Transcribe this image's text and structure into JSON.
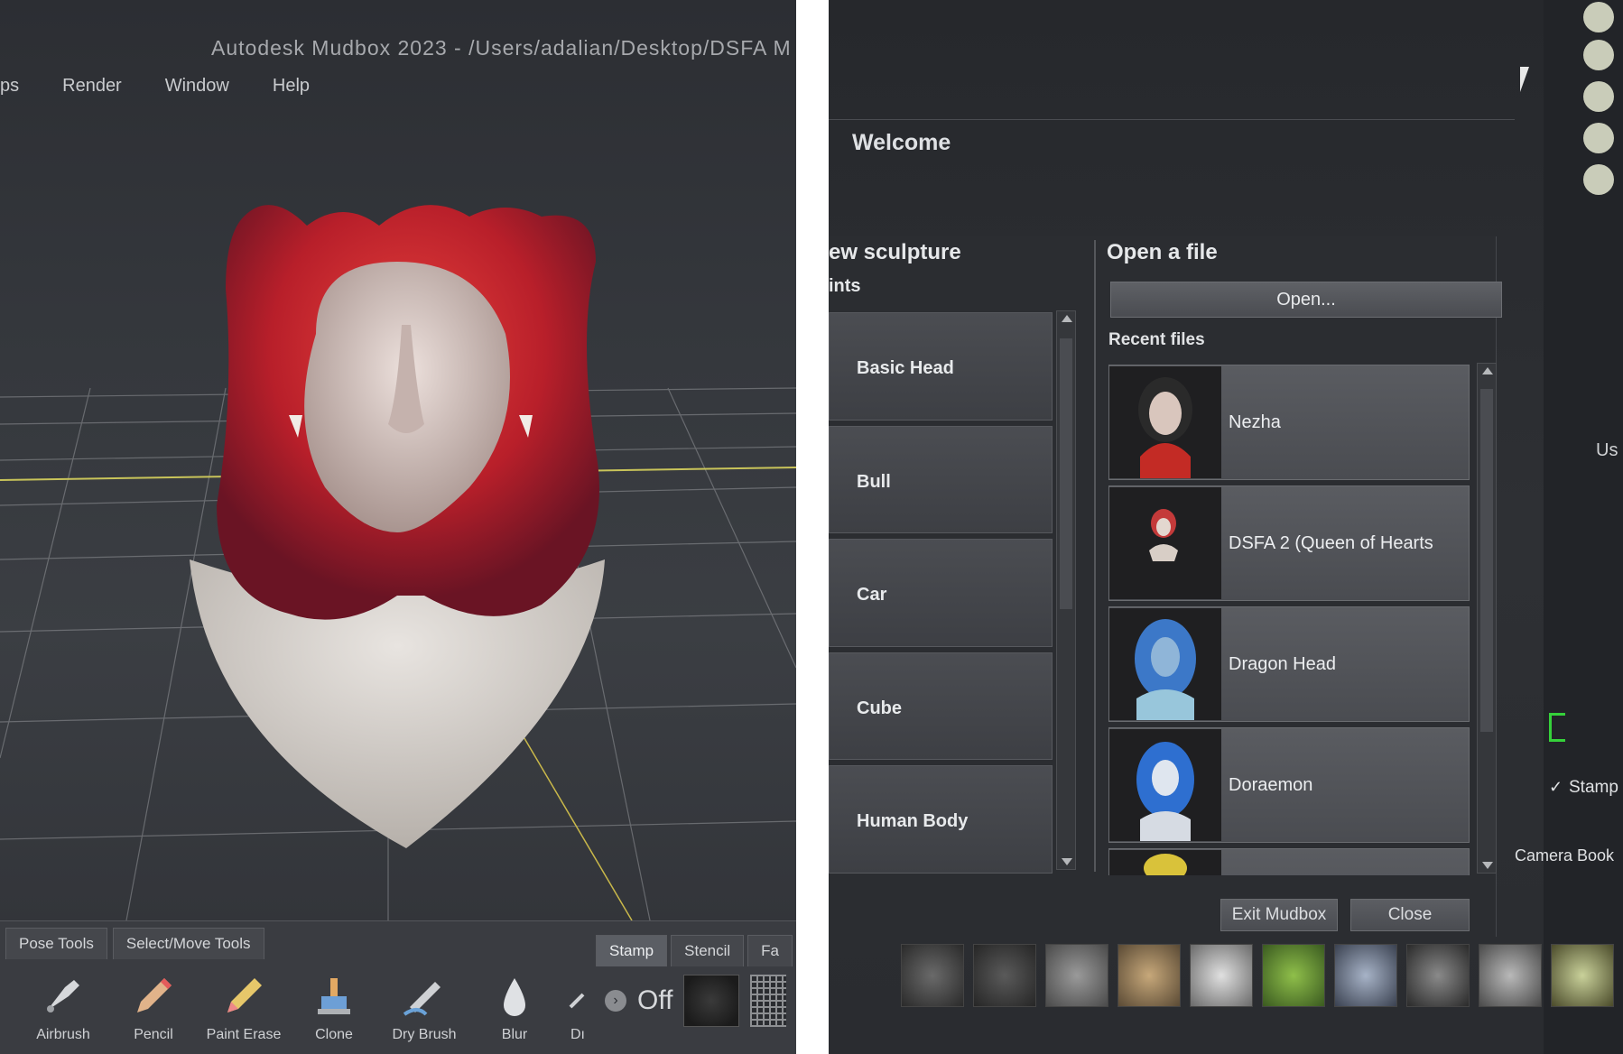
{
  "left": {
    "title": "Autodesk Mudbox 2023 - /Users/adalian/Desktop/DSFA M",
    "menu": [
      "ps",
      "Render",
      "Window",
      "Help"
    ],
    "toolset_tabs": [
      "Pose Tools",
      "Select/Move Tools"
    ],
    "stamp_tabs": [
      "Stamp",
      "Stencil",
      "Fa"
    ],
    "tools": [
      {
        "label": "Airbrush",
        "icon": "airbrush-icon"
      },
      {
        "label": "Pencil",
        "icon": "pencil-icon"
      },
      {
        "label": "Paint Erase",
        "icon": "paint-erase-icon"
      },
      {
        "label": "Clone",
        "icon": "clone-icon"
      },
      {
        "label": "Dry Brush",
        "icon": "dry-brush-icon"
      },
      {
        "label": "Blur",
        "icon": "blur-icon"
      },
      {
        "label": "Dı",
        "icon": "tool-icon"
      }
    ],
    "stamp_state": "Off"
  },
  "right": {
    "welcome": "Welcome",
    "new_sculpture": "ew sculpture",
    "prints": "ints",
    "open_file": "Open a file",
    "open_button": "Open...",
    "recent_files_label": "Recent files",
    "sculptures": [
      "Basic Head",
      "Bull",
      "Car",
      "Cube",
      "Human Body"
    ],
    "recent_files": [
      "Nezha",
      "DSFA 2 (Queen of Hearts",
      "Dragon Head",
      "Doraemon"
    ],
    "exit_button": "Exit Mudbox",
    "close_button": "Close",
    "stamp_label": "Stamp",
    "camera_label": "Camera Book",
    "side_label": "Us"
  }
}
